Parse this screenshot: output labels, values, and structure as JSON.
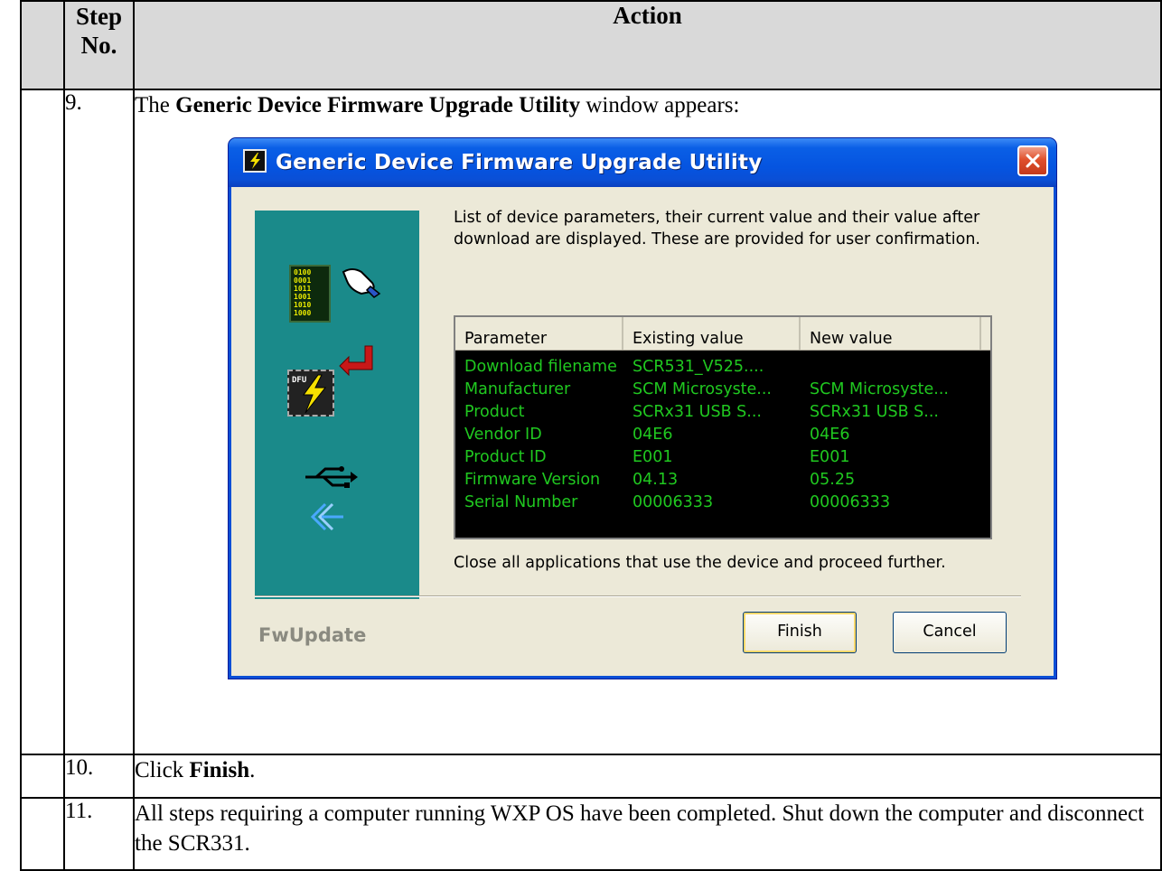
{
  "table": {
    "header_step": "Step No.",
    "header_action": "Action"
  },
  "steps": [
    {
      "number": "9.",
      "text_pre": "The ",
      "text_bold": "Generic Device Firmware Upgrade Utility",
      "text_post": " window appears:"
    },
    {
      "number": "10.",
      "text_pre": "Click ",
      "text_bold": "Finish",
      "text_post": "."
    },
    {
      "number": "11.",
      "text": "All steps requiring a computer running WXP OS have been completed.  Shut down the computer and disconnect the SCR331."
    }
  ],
  "dialog": {
    "title": "Generic Device Firmware Upgrade Utility",
    "intro": "List of device parameters, their current value and their value after download are displayed. These are provided for user confirmation.",
    "columns": [
      "Parameter",
      "Existing value",
      "New value"
    ],
    "rows": [
      [
        "Download filename",
        "SCR531_V525....",
        ""
      ],
      [
        "Manufacturer",
        "SCM Microsyste...",
        "SCM Microsyste..."
      ],
      [
        "Product",
        "SCRx31 USB S...",
        "SCRx31 USB S..."
      ],
      [
        "Vendor ID",
        "04E6",
        "04E6"
      ],
      [
        "Product ID",
        "E001",
        "E001"
      ],
      [
        "Firmware Version",
        "04.13",
        "05.25"
      ],
      [
        "Serial Number",
        "00006333",
        "00006333"
      ]
    ],
    "closing": "Close all applications that use the device and proceed further.",
    "brand": "FwUpdate",
    "finish_label": "Finish",
    "cancel_label": "Cancel",
    "binary_lines": [
      "0100",
      "0001",
      "1011",
      "1001",
      "1010",
      "1000"
    ],
    "dfu_label": "DFU",
    "colors": {
      "panel": "#1a8a8a",
      "list_text": "#20c820",
      "titlebar": "#0554e0"
    }
  }
}
